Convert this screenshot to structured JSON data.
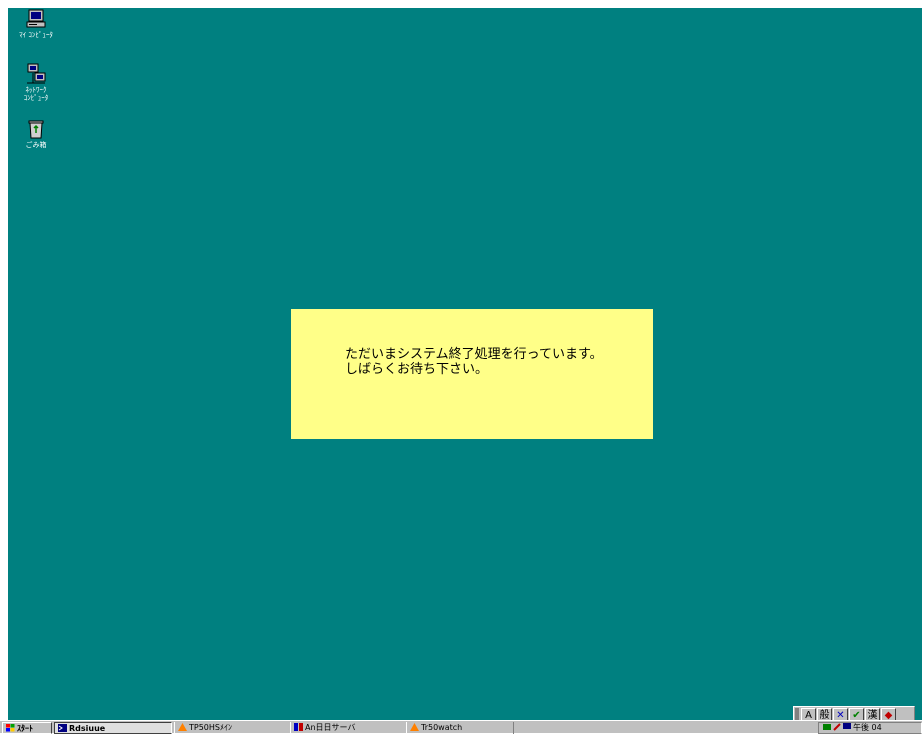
{
  "desktop": {
    "background": "#008080",
    "icons": [
      {
        "label": "ﾏｲ ｺﾝﾋﾟｭｰﾀ",
        "icon": "my-computer-icon"
      },
      {
        "label": "ﾈｯﾄﾜｰｸ\nｺﾝﾋﾟｭｰﾀ",
        "icon": "network-computer-icon"
      },
      {
        "label": "ごみ箱",
        "icon": "recycle-bin-icon"
      }
    ]
  },
  "dialog": {
    "background": "#ffff88",
    "line1": "ただいまシステム終了処理を行っています。",
    "line2": "しばらくお待ち下さい。"
  },
  "ime_bar": {
    "buttons": [
      "A",
      "般",
      "✕",
      "✔",
      "漢",
      "◆"
    ]
  },
  "taskbar": {
    "start_label": "ｽﾀｰﾄ",
    "tasks": [
      {
        "label": "Rdsiuue",
        "active": true
      },
      {
        "label": "TP50HSﾒｲﾝ",
        "active": false
      },
      {
        "label": "An日日サーバ",
        "active": false
      },
      {
        "label": "Tr50watch",
        "active": false
      }
    ],
    "tray_clock": "午後 04"
  }
}
